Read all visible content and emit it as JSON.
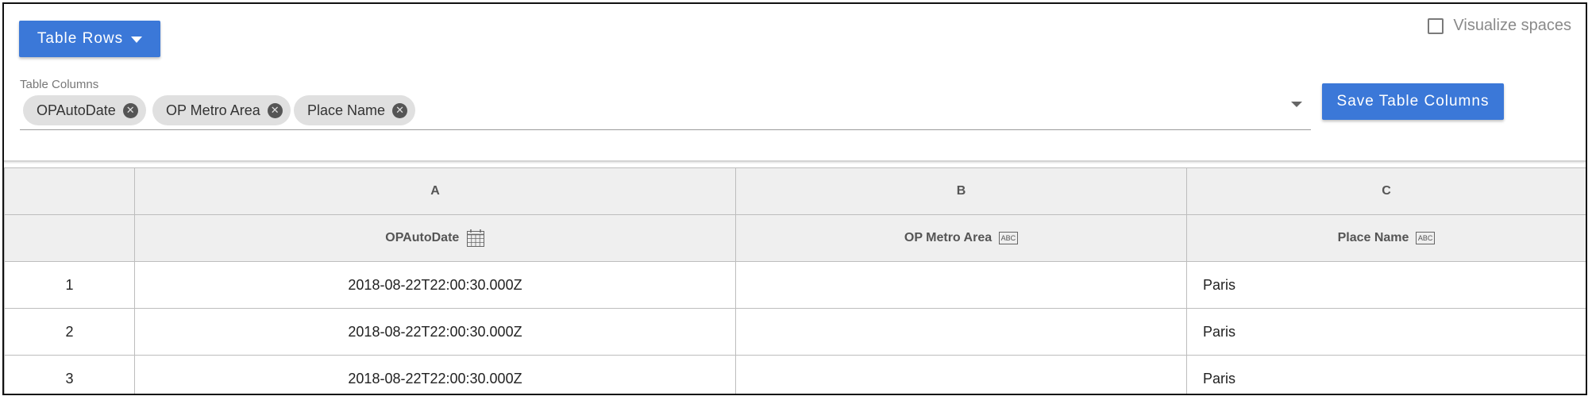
{
  "toolbar": {
    "table_rows_label": "Table Rows",
    "visualize_spaces_label": "Visualize spaces",
    "visualize_spaces_checked": false,
    "save_columns_label": "Save Table Columns"
  },
  "columns_selector": {
    "label": "Table Columns",
    "chips": [
      {
        "label": "OPAutoDate"
      },
      {
        "label": "OP Metro Area"
      },
      {
        "label": "Place Name"
      }
    ]
  },
  "table": {
    "letters": [
      "A",
      "B",
      "C"
    ],
    "headers": [
      {
        "name": "OPAutoDate",
        "type_icon": "calendar-icon"
      },
      {
        "name": "OP Metro Area",
        "type_icon": "text-type-icon",
        "type_label": "ABC"
      },
      {
        "name": "Place Name",
        "type_icon": "text-type-icon",
        "type_label": "ABC"
      }
    ],
    "rows": [
      {
        "num": "1",
        "a": "2018-08-22T22:00:30.000Z",
        "b": "",
        "c": "Paris"
      },
      {
        "num": "2",
        "a": "2018-08-22T22:00:30.000Z",
        "b": "",
        "c": "Paris"
      },
      {
        "num": "3",
        "a": "2018-08-22T22:00:30.000Z",
        "b": "",
        "c": "Paris"
      }
    ]
  },
  "colors": {
    "primary_button": "#3b78d8",
    "chip_background": "#e0e0e0",
    "header_background": "#efefef"
  }
}
